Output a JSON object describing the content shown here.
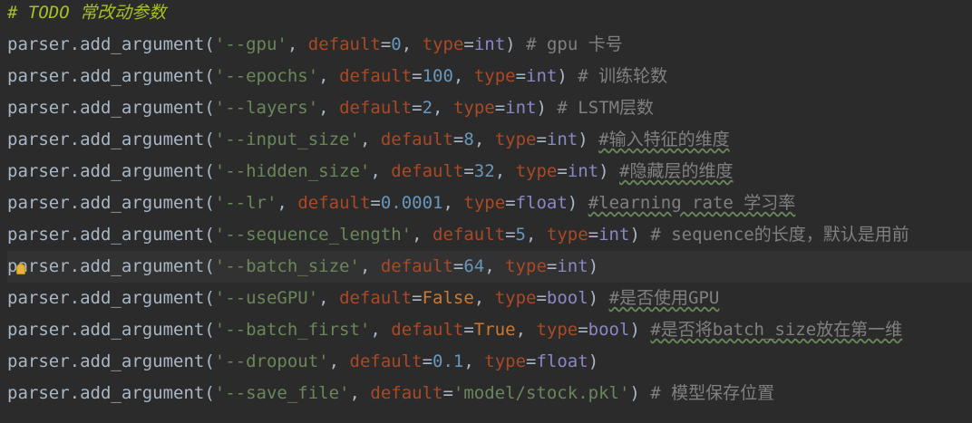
{
  "editor": {
    "lines": [
      {
        "tokens": [
          {
            "t": "# TODO 常改动参数",
            "c": "c-todo"
          }
        ]
      },
      {
        "tokens": [
          {
            "t": "parser.add_argument(",
            "c": "c-plain"
          },
          {
            "t": "'--gpu'",
            "c": "c-str"
          },
          {
            "t": ", ",
            "c": "c-plain"
          },
          {
            "t": "default",
            "c": "c-kw"
          },
          {
            "t": "=",
            "c": "c-plain"
          },
          {
            "t": "0",
            "c": "c-num"
          },
          {
            "t": ", ",
            "c": "c-plain"
          },
          {
            "t": "type",
            "c": "c-kw"
          },
          {
            "t": "=",
            "c": "c-plain"
          },
          {
            "t": "int",
            "c": "c-builtin"
          },
          {
            "t": ") ",
            "c": "c-plain"
          },
          {
            "t": "# gpu 卡号",
            "c": "c-comment"
          }
        ]
      },
      {
        "tokens": [
          {
            "t": "parser.add_argument(",
            "c": "c-plain"
          },
          {
            "t": "'--epochs'",
            "c": "c-str"
          },
          {
            "t": ", ",
            "c": "c-plain"
          },
          {
            "t": "default",
            "c": "c-kw"
          },
          {
            "t": "=",
            "c": "c-plain"
          },
          {
            "t": "100",
            "c": "c-num"
          },
          {
            "t": ", ",
            "c": "c-plain"
          },
          {
            "t": "type",
            "c": "c-kw"
          },
          {
            "t": "=",
            "c": "c-plain"
          },
          {
            "t": "int",
            "c": "c-builtin"
          },
          {
            "t": ") ",
            "c": "c-plain"
          },
          {
            "t": "# 训练轮数",
            "c": "c-comment"
          }
        ]
      },
      {
        "tokens": [
          {
            "t": "parser.add_argument(",
            "c": "c-plain"
          },
          {
            "t": "'--layers'",
            "c": "c-str"
          },
          {
            "t": ", ",
            "c": "c-plain"
          },
          {
            "t": "default",
            "c": "c-kw"
          },
          {
            "t": "=",
            "c": "c-plain"
          },
          {
            "t": "2",
            "c": "c-num"
          },
          {
            "t": ", ",
            "c": "c-plain"
          },
          {
            "t": "type",
            "c": "c-kw"
          },
          {
            "t": "=",
            "c": "c-plain"
          },
          {
            "t": "int",
            "c": "c-builtin"
          },
          {
            "t": ") ",
            "c": "c-plain"
          },
          {
            "t": "# LSTM层数",
            "c": "c-comment"
          }
        ]
      },
      {
        "tokens": [
          {
            "t": "parser.add_argument(",
            "c": "c-plain"
          },
          {
            "t": "'--input_size'",
            "c": "c-str"
          },
          {
            "t": ", ",
            "c": "c-plain"
          },
          {
            "t": "default",
            "c": "c-kw"
          },
          {
            "t": "=",
            "c": "c-plain"
          },
          {
            "t": "8",
            "c": "c-num"
          },
          {
            "t": ", ",
            "c": "c-plain"
          },
          {
            "t": "type",
            "c": "c-kw"
          },
          {
            "t": "=",
            "c": "c-plain"
          },
          {
            "t": "int",
            "c": "c-builtin"
          },
          {
            "t": ") ",
            "c": "c-plain"
          },
          {
            "t": "#输入特征的维度",
            "c": "c-comment squig"
          }
        ]
      },
      {
        "tokens": [
          {
            "t": "parser.add_argument(",
            "c": "c-plain"
          },
          {
            "t": "'--hidden_size'",
            "c": "c-str"
          },
          {
            "t": ", ",
            "c": "c-plain"
          },
          {
            "t": "default",
            "c": "c-kw"
          },
          {
            "t": "=",
            "c": "c-plain"
          },
          {
            "t": "32",
            "c": "c-num"
          },
          {
            "t": ", ",
            "c": "c-plain"
          },
          {
            "t": "type",
            "c": "c-kw"
          },
          {
            "t": "=",
            "c": "c-plain"
          },
          {
            "t": "int",
            "c": "c-builtin"
          },
          {
            "t": ") ",
            "c": "c-plain"
          },
          {
            "t": "#隐藏层的维度",
            "c": "c-comment squig"
          }
        ]
      },
      {
        "tokens": [
          {
            "t": "parser.add_argument(",
            "c": "c-plain"
          },
          {
            "t": "'--lr'",
            "c": "c-str"
          },
          {
            "t": ", ",
            "c": "c-plain"
          },
          {
            "t": "default",
            "c": "c-kw"
          },
          {
            "t": "=",
            "c": "c-plain"
          },
          {
            "t": "0.0001",
            "c": "c-num"
          },
          {
            "t": ", ",
            "c": "c-plain"
          },
          {
            "t": "type",
            "c": "c-kw"
          },
          {
            "t": "=",
            "c": "c-plain"
          },
          {
            "t": "float",
            "c": "c-builtin"
          },
          {
            "t": ") ",
            "c": "c-plain"
          },
          {
            "t": "#learning rate 学习率",
            "c": "c-comment squig"
          }
        ]
      },
      {
        "tokens": [
          {
            "t": "parser.add_argument(",
            "c": "c-plain"
          },
          {
            "t": "'--sequence_length'",
            "c": "c-str"
          },
          {
            "t": ", ",
            "c": "c-plain"
          },
          {
            "t": "default",
            "c": "c-kw"
          },
          {
            "t": "=",
            "c": "c-plain"
          },
          {
            "t": "5",
            "c": "c-num"
          },
          {
            "t": ", ",
            "c": "c-plain"
          },
          {
            "t": "type",
            "c": "c-kw"
          },
          {
            "t": "=",
            "c": "c-plain"
          },
          {
            "t": "int",
            "c": "c-builtin"
          },
          {
            "t": ") ",
            "c": "c-plain"
          },
          {
            "t": "# sequence的长度，默认是用前",
            "c": "c-comment"
          }
        ]
      },
      {
        "active": true,
        "tokens": [
          {
            "t": "parser.add_argument(",
            "c": "c-plain"
          },
          {
            "t": "'--batch_size'",
            "c": "c-str"
          },
          {
            "t": ", ",
            "c": "c-plain"
          },
          {
            "t": "default",
            "c": "c-kw"
          },
          {
            "t": "=",
            "c": "c-plain"
          },
          {
            "t": "64",
            "c": "c-num"
          },
          {
            "t": ", ",
            "c": "c-plain"
          },
          {
            "t": "type",
            "c": "c-kw"
          },
          {
            "t": "=",
            "c": "c-plain"
          },
          {
            "t": "int",
            "c": "c-builtin"
          },
          {
            "t": ")",
            "c": "c-plain"
          }
        ]
      },
      {
        "tokens": [
          {
            "t": "parser.add_argument(",
            "c": "c-plain"
          },
          {
            "t": "'--useGPU'",
            "c": "c-str"
          },
          {
            "t": ", ",
            "c": "c-plain"
          },
          {
            "t": "default",
            "c": "c-kw"
          },
          {
            "t": "=",
            "c": "c-plain"
          },
          {
            "t": "False",
            "c": "c-const"
          },
          {
            "t": ", ",
            "c": "c-plain"
          },
          {
            "t": "type",
            "c": "c-kw"
          },
          {
            "t": "=",
            "c": "c-plain"
          },
          {
            "t": "bool",
            "c": "c-builtin"
          },
          {
            "t": ") ",
            "c": "c-plain"
          },
          {
            "t": "#是否使用GPU",
            "c": "c-comment squig"
          }
        ]
      },
      {
        "tokens": [
          {
            "t": "parser.add_argument(",
            "c": "c-plain"
          },
          {
            "t": "'--batch_first'",
            "c": "c-str"
          },
          {
            "t": ", ",
            "c": "c-plain"
          },
          {
            "t": "default",
            "c": "c-kw"
          },
          {
            "t": "=",
            "c": "c-plain"
          },
          {
            "t": "True",
            "c": "c-const"
          },
          {
            "t": ", ",
            "c": "c-plain"
          },
          {
            "t": "type",
            "c": "c-kw"
          },
          {
            "t": "=",
            "c": "c-plain"
          },
          {
            "t": "bool",
            "c": "c-builtin"
          },
          {
            "t": ") ",
            "c": "c-plain"
          },
          {
            "t": "#是否将batch_size放在第一维",
            "c": "c-comment squig"
          }
        ]
      },
      {
        "tokens": [
          {
            "t": "parser.add_argument(",
            "c": "c-plain"
          },
          {
            "t": "'--dropout'",
            "c": "c-str"
          },
          {
            "t": ", ",
            "c": "c-plain"
          },
          {
            "t": "default",
            "c": "c-kw"
          },
          {
            "t": "=",
            "c": "c-plain"
          },
          {
            "t": "0.1",
            "c": "c-num"
          },
          {
            "t": ", ",
            "c": "c-plain"
          },
          {
            "t": "type",
            "c": "c-kw"
          },
          {
            "t": "=",
            "c": "c-plain"
          },
          {
            "t": "float",
            "c": "c-builtin"
          },
          {
            "t": ")",
            "c": "c-plain"
          }
        ]
      },
      {
        "tokens": [
          {
            "t": "parser.add_argument(",
            "c": "c-plain"
          },
          {
            "t": "'--save_file'",
            "c": "c-str"
          },
          {
            "t": ", ",
            "c": "c-plain"
          },
          {
            "t": "default",
            "c": "c-kw"
          },
          {
            "t": "=",
            "c": "c-plain"
          },
          {
            "t": "'model/stock.pkl'",
            "c": "c-str"
          },
          {
            "t": ") ",
            "c": "c-plain"
          },
          {
            "t": "# 模型保存位置",
            "c": "c-comment"
          }
        ]
      }
    ],
    "intention_icon": "lightbulb-icon"
  }
}
